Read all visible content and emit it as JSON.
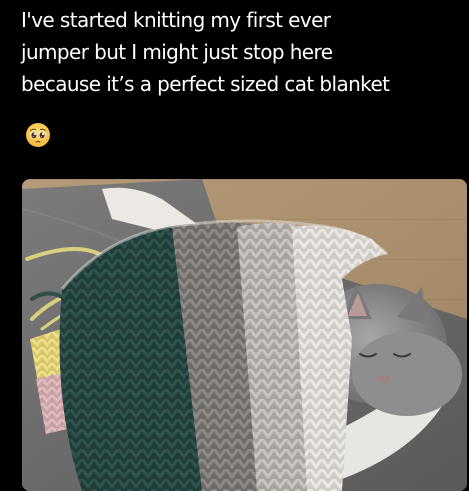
{
  "post": {
    "text_lines": [
      "I've started knitting my first ever",
      "jumper but I might just stop here",
      "because it’s a perfect sized cat blanket"
    ],
    "emoji": "pleading-face-icon"
  },
  "photo": {
    "subject": "grey-cat-under-knitted-blanket"
  }
}
